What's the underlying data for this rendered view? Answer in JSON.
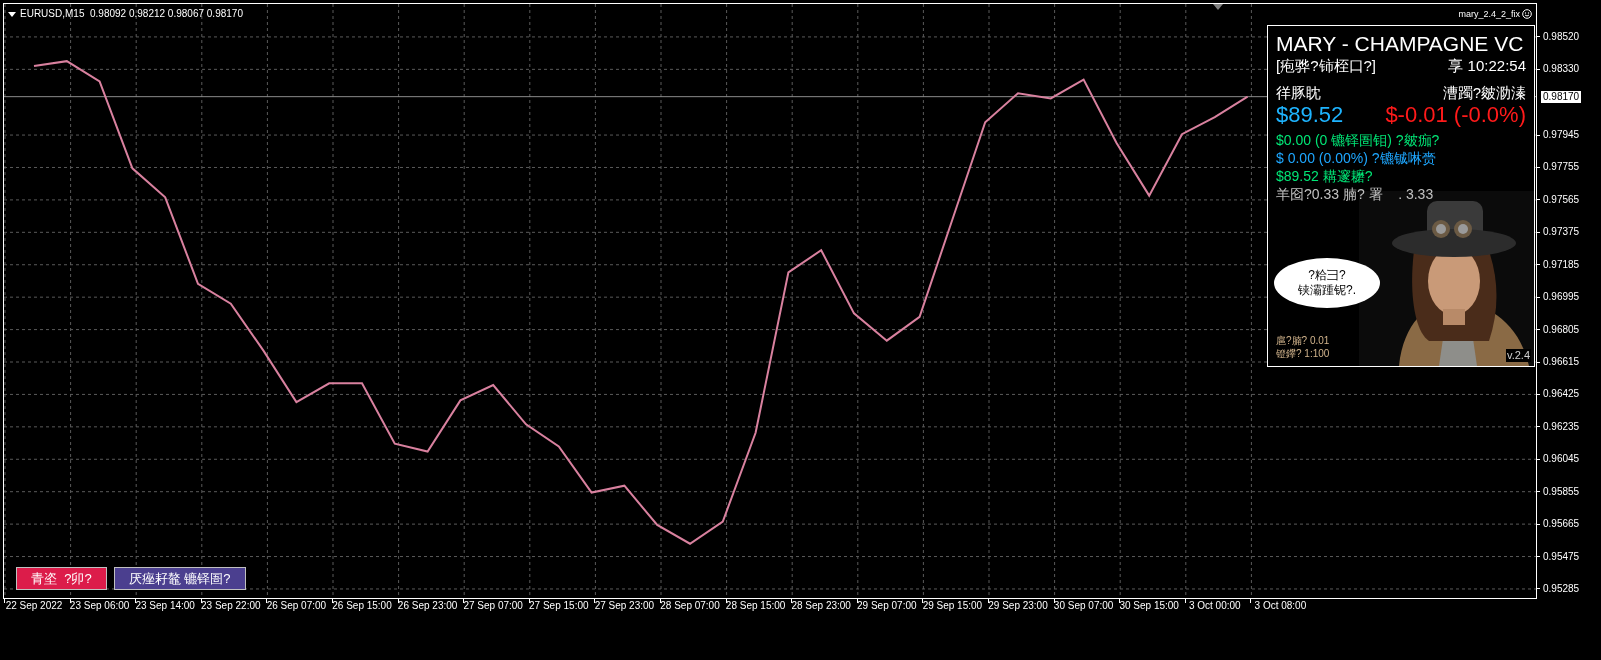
{
  "chart": {
    "header": "EURUSD,M15  0.98092 0.98212 0.98067 0.98170",
    "indicator_label": "mary_2.4_2_fix",
    "chart_data": {
      "type": "line",
      "categories": [
        "22 Sep 2022",
        null,
        "23 Sep 06:00",
        null,
        "23 Sep 14:00",
        null,
        "23 Sep 22:00",
        null,
        "26 Sep 07:00",
        null,
        "26 Sep 15:00",
        null,
        "26 Sep 23:00",
        null,
        "27 Sep 07:00",
        null,
        "27 Sep 15:00",
        null,
        "27 Sep 23:00",
        null,
        "28 Sep 07:00",
        null,
        "28 Sep 15:00",
        null,
        "28 Sep 23:00",
        null,
        "29 Sep 07:00",
        null,
        "29 Sep 15:00",
        null,
        "29 Sep 23:00",
        null,
        "30 Sep 07:00",
        null,
        "30 Sep 15:00",
        null,
        "3 Oct 00:00",
        null,
        "3 Oct 08:00"
      ],
      "series": [
        {
          "color": "#d9819f",
          "values": [
            0.98349,
            0.98378,
            0.9826,
            0.9775,
            0.9758,
            0.97073,
            0.96957,
            0.9668,
            0.9638,
            0.9649,
            0.9649,
            0.96136,
            0.9609,
            0.9639,
            0.9648,
            0.9625,
            0.9612,
            0.9585,
            0.9589,
            0.9566,
            0.9555,
            0.9568,
            0.962,
            0.9714,
            0.9727,
            0.969,
            0.9674,
            0.9688,
            0.9745,
            0.9802,
            0.9819,
            0.9816,
            0.9827,
            0.979,
            0.9759,
            0.9795,
            0.9805,
            0.9817,
            null
          ]
        }
      ],
      "ylim": [
        0.95232,
        0.98713
      ],
      "grid": true,
      "ref_lines": [
        {
          "axis": "y",
          "value": 0.9817,
          "label": "0.98170"
        }
      ],
      "yticks": [
        {
          "value": 0.9852,
          "label": "0.98520"
        },
        {
          "value": 0.9833,
          "label": "0.98330"
        },
        {
          "value": 0.97945,
          "label": "0.97945"
        },
        {
          "value": 0.97755,
          "label": "0.97755"
        },
        {
          "value": 0.97565,
          "label": "0.97565"
        },
        {
          "value": 0.97375,
          "label": "0.97375"
        },
        {
          "value": 0.97185,
          "label": "0.97185"
        },
        {
          "value": 0.96995,
          "label": "0.96995"
        },
        {
          "value": 0.96805,
          "label": "0.96805"
        },
        {
          "value": 0.96615,
          "label": "0.96615"
        },
        {
          "value": 0.96425,
          "label": "0.96425"
        },
        {
          "value": 0.96235,
          "label": "0.96235"
        },
        {
          "value": 0.96045,
          "label": "0.96045"
        },
        {
          "value": 0.95855,
          "label": "0.95855"
        },
        {
          "value": 0.95665,
          "label": "0.95665"
        },
        {
          "value": 0.95475,
          "label": "0.95475"
        },
        {
          "value": 0.95285,
          "label": "0.95285"
        }
      ]
    }
  },
  "panel": {
    "title": "MARY - CHAMPAGNE VC",
    "subtitle": "[疱骅?铈桎口?]",
    "clock": "享 10:22:54",
    "balance_label": "徉豚眈",
    "profit_label": "漕躅?皴泐溱",
    "balance": "$89.52",
    "profit": "$-0.01 (-0.0%)",
    "lines": [
      {
        "text": "$0.00 (0 镳铎圄钼) ?皴痂?",
        "color": "#00e676"
      },
      {
        "text": "$ 0.00 (0.00%) ?镳铖啉赍",
        "color": "#1ea7ff"
      },
      {
        "text": "$89.52 耩邃耱?",
        "color": "#00e676"
      },
      {
        "text": "羊囵?0.33 腩? 署    . 3.33",
        "color": "#c0c0c0"
      }
    ],
    "speech": [
      "?粭彐?",
      "铗灞踵铌?."
    ],
    "lot": "扈?腩? 0.01",
    "leverage": "镫鑻? 1:100",
    "version": "v.2.4"
  },
  "buttons": [
    {
      "label": "青垐  ?卯?",
      "color": "#dc1c4a"
    },
    {
      "label": "厌痤耔鼇 镳铎圄?",
      "color": "#4b3f8f"
    }
  ]
}
